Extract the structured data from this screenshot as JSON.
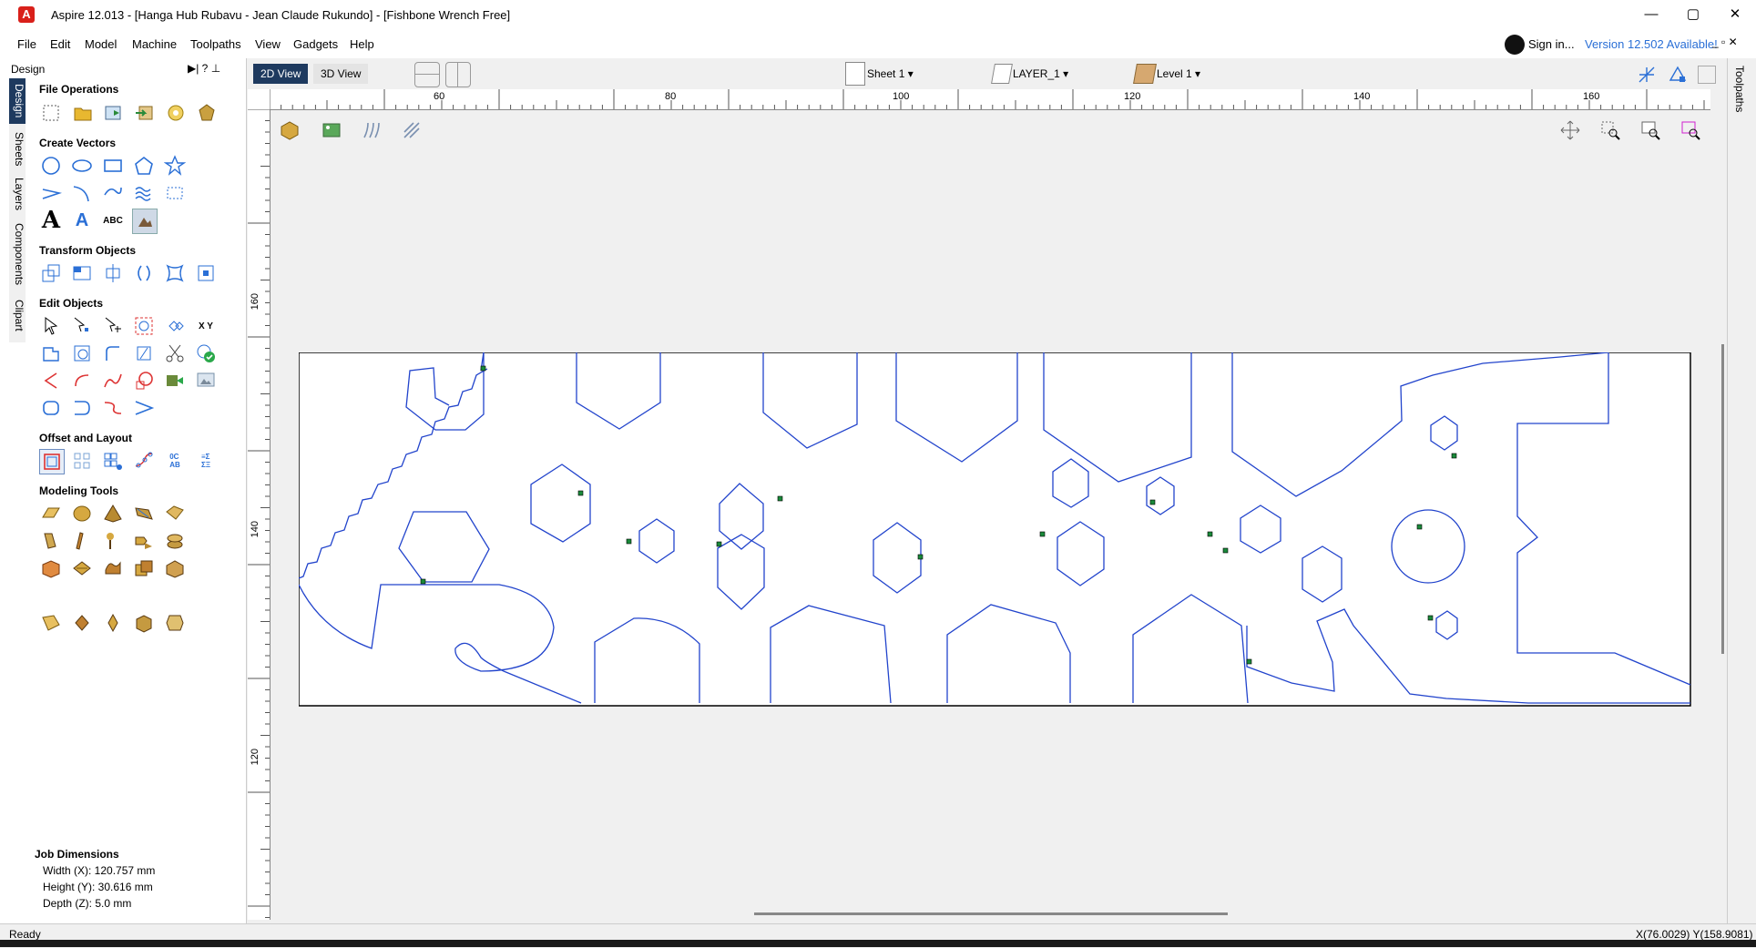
{
  "window": {
    "title": "Aspire 12.013 - [Hanga Hub Rubavu - Jean Claude Rukundo] - [Fishbone Wrench Free]",
    "minimize": "—",
    "maximize": "▢",
    "close": "✕"
  },
  "menu": [
    "File",
    "Edit",
    "Model",
    "Machine",
    "Toolpaths",
    "View",
    "Gadgets",
    "Help"
  ],
  "account": {
    "signin": "Sign in...",
    "version": "Version 12.502 Available!"
  },
  "panel": {
    "title": "Design",
    "vtabs": [
      "Design",
      "Sheets",
      "Layers",
      "Components",
      "Clipart"
    ],
    "sections": [
      "File Operations",
      "Create Vectors",
      "Transform Objects",
      "Edit Objects",
      "Offset and Layout",
      "Modeling Tools"
    ],
    "xy_label": "X Y"
  },
  "job": {
    "heading": "Job Dimensions",
    "width": "Width  (X): 120.757 mm",
    "height": "Height (Y): 30.616 mm",
    "depth": "Depth  (Z): 5.0 mm"
  },
  "viewbar": {
    "tab2d": "2D View",
    "tab3d": "3D View",
    "sheet": "Sheet 1",
    "layer": "LAYER_1",
    "level": "Level 1"
  },
  "ruler": {
    "top_labels": [
      "60",
      "80",
      "100",
      "120",
      "140",
      "160"
    ],
    "left_labels": [
      "160",
      "140",
      "120"
    ]
  },
  "right_tab": "Toolpaths",
  "status": {
    "text": "Ready",
    "coords": "X(76.0029) Y(158.9081)"
  },
  "colors": {
    "vector": "#2244cc",
    "node": "#1a8a3a",
    "accent_red": "#d9201a",
    "link": "#2a6fd6"
  }
}
